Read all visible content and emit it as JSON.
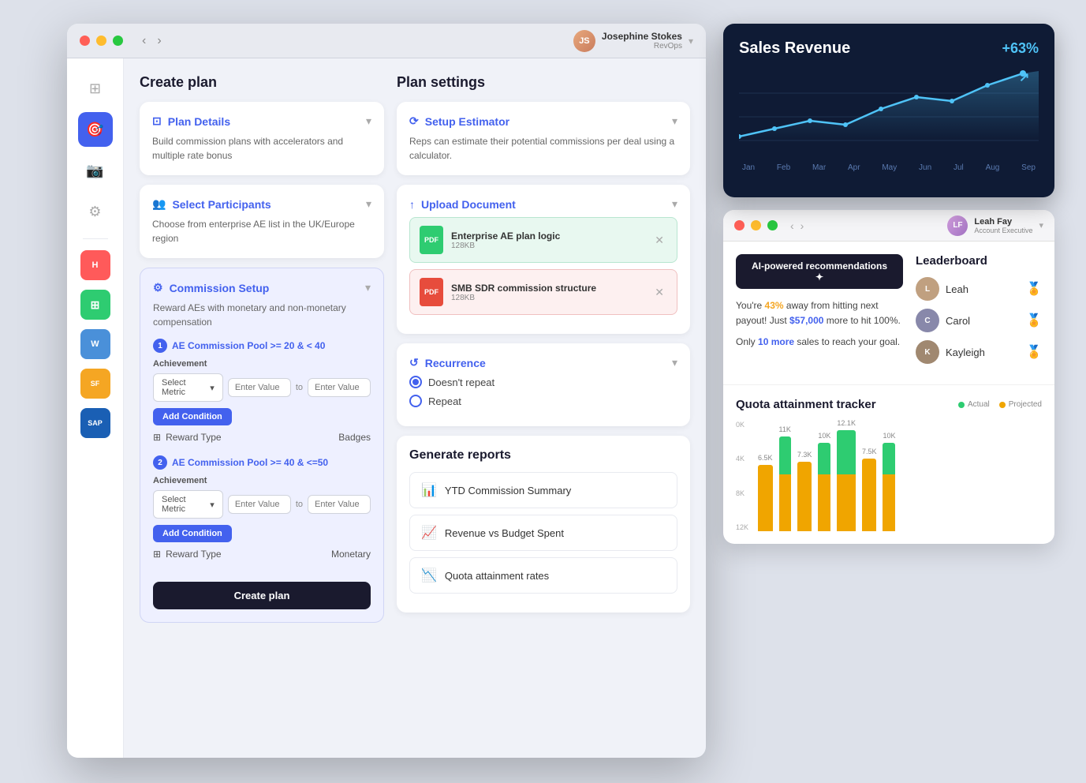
{
  "mainWindow": {
    "user": {
      "name": "Josephine Stokes",
      "role": "RevOps",
      "initials": "JS"
    },
    "sidebar": {
      "icons": [
        "⊞",
        "🎯",
        "📷",
        "⚙"
      ]
    },
    "createPlan": {
      "title": "Create plan",
      "planDetails": {
        "title": "Plan Details",
        "description": "Build commission plans with accelerators and multiple rate bonus",
        "icon": "⊡"
      },
      "selectParticipants": {
        "title": "Select Participants",
        "description": "Choose from enterprise AE list in the UK/Europe region",
        "icon": "👥"
      },
      "commissionSetup": {
        "title": "Commission Setup",
        "description": "Reward AEs with monetary and non-monetary compensation",
        "icon": "⚙",
        "tiers": [
          {
            "number": "1",
            "label": "AE Commission Pool >= 20 & < 40",
            "achievementLabel": "Achievement",
            "selectMetric": "Select Metric",
            "enterValue1": "Enter Value",
            "to": "to",
            "enterValue2": "Enter Value",
            "addCondition": "Add Condition",
            "rewardTypeLabel": "Reward Type",
            "rewardTypeValue": "Badges"
          },
          {
            "number": "2",
            "label": "AE Commission Pool >= 40 & <=50",
            "achievementLabel": "Achievement",
            "selectMetric": "Select Metric",
            "enterValue1": "Enter Value",
            "to": "to",
            "enterValue2": "Enter Value",
            "addCondition": "Add Condition",
            "rewardTypeLabel": "Reward Type",
            "rewardTypeValue": "Monetary"
          }
        ],
        "createPlanBtn": "Create plan"
      }
    },
    "planSettings": {
      "title": "Plan settings",
      "setupEstimator": {
        "title": "Setup Estimator",
        "description": "Reps can estimate their potential commissions per deal using a calculator.",
        "icon": "⟳"
      },
      "uploadDocument": {
        "title": "Upload Document",
        "icon": "↑",
        "files": [
          {
            "name": "Enterprise AE plan logic",
            "size": "128KB",
            "color": "green"
          },
          {
            "name": "SMB SDR commission structure",
            "size": "128KB",
            "color": "red"
          }
        ]
      },
      "recurrence": {
        "title": "Recurrence",
        "options": [
          "Doesn't repeat",
          "Repeat"
        ],
        "selected": "Doesn't repeat"
      },
      "generateReports": {
        "title": "Generate reports",
        "reports": [
          {
            "name": "YTD Commission Summary",
            "icon": "📊"
          },
          {
            "name": "Revenue vs Budget Spent",
            "icon": "📈"
          },
          {
            "name": "Quota attainment rates",
            "icon": "📉"
          }
        ]
      }
    }
  },
  "salesCard": {
    "title": "Sales Revenue",
    "change": "+63%",
    "labels": [
      "Jan",
      "Feb",
      "Mar",
      "Apr",
      "May",
      "Jun",
      "Jul",
      "Aug",
      "Sep"
    ]
  },
  "rightWindow": {
    "user": {
      "name": "Leah Fay",
      "role": "Account Executive",
      "initials": "LF"
    },
    "ai": {
      "buttonLabel": "AI-powered recommendations ✦",
      "text1": "You're ",
      "highlight1": "43%",
      "text2": " away from hitting next payout! Just ",
      "highlight2": "$57,000",
      "text3": " more to hit 100%.",
      "text4": "Only ",
      "highlight3": "10 more",
      "text5": " sales to reach your goal."
    },
    "leaderboard": {
      "title": "Leaderboard",
      "items": [
        {
          "name": "Leah",
          "initials": "L",
          "color": "#c0a080"
        },
        {
          "name": "Carol",
          "initials": "C",
          "color": "#8888aa"
        },
        {
          "name": "Kayleigh",
          "initials": "K",
          "color": "#a08870"
        }
      ]
    },
    "quota": {
      "title": "Quota attainment tracker",
      "legend": {
        "actual": "Actual",
        "projected": "Projected"
      },
      "bars": [
        {
          "label": "",
          "actual": 65,
          "projected": 0,
          "topValue": "6.5K"
        },
        {
          "label": "",
          "actual": 73,
          "projected": 38,
          "topValue": "11K"
        },
        {
          "label": "",
          "actual": 73,
          "projected": 0,
          "topValue": "7.3K"
        },
        {
          "label": "",
          "actual": 50,
          "projected": 50,
          "topValue": "10K"
        },
        {
          "label": "",
          "actual": 85,
          "projected": 27,
          "topValue": "12.1K"
        },
        {
          "label": "",
          "actual": 75,
          "projected": 0,
          "topValue": "7.5K"
        },
        {
          "label": "",
          "actual": 50,
          "projected": 50,
          "topValue": "10K"
        }
      ],
      "yLabels": [
        "0K",
        "4K",
        "8K",
        "12K"
      ]
    }
  },
  "integrations": [
    {
      "label": "H",
      "color": "#ff5a5a",
      "name": "HubSpot"
    },
    {
      "label": "⊞",
      "color": "#2ecc71",
      "name": "Sheets"
    },
    {
      "label": "W",
      "color": "#4a90d9",
      "name": "Word"
    },
    {
      "label": "S",
      "color": "#f5a623",
      "name": "Salesforce"
    },
    {
      "label": "SAP",
      "color": "#1a5fb4",
      "name": "SAP"
    }
  ]
}
